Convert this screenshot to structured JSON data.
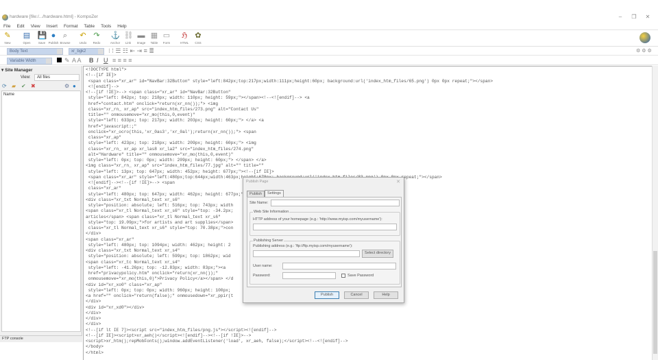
{
  "window": {
    "title": "hardware [file:/.../hardware.html] - KompoZer",
    "controls": [
      "–",
      "❐",
      "✕"
    ]
  },
  "menu": [
    "File",
    "Edit",
    "View",
    "Insert",
    "Format",
    "Table",
    "Tools",
    "Help"
  ],
  "toolbar": [
    {
      "label": "New",
      "icon": "pencil-icon",
      "glyph": "✎",
      "color": "#c9a000"
    },
    {
      "label": "Open",
      "icon": "open-icon",
      "glyph": "▤",
      "color": "#3a6fb0"
    },
    {
      "label": "Save",
      "icon": "save-icon",
      "glyph": "💾",
      "color": "#333"
    },
    {
      "label": "Publish",
      "icon": "globe-icon",
      "glyph": "●",
      "color": "#2d7fc4"
    },
    {
      "label": "Browse",
      "icon": "magnifier-icon",
      "glyph": "⌕",
      "color": "#777"
    },
    {
      "label": "Undo",
      "icon": "undo-icon",
      "glyph": "↶",
      "color": "#c9a000"
    },
    {
      "label": "Redo",
      "icon": "redo-icon",
      "glyph": "↷",
      "color": "#4a9a4a"
    },
    {
      "label": "Anchor",
      "icon": "anchor-icon",
      "glyph": "⚓",
      "color": "#999"
    },
    {
      "label": "Link",
      "icon": "link-icon",
      "glyph": "⛓",
      "color": "#aaa"
    },
    {
      "label": "Image",
      "icon": "image-icon",
      "glyph": "▬",
      "color": "#888"
    },
    {
      "label": "Table",
      "icon": "table-icon",
      "glyph": "▦",
      "color": "#999"
    },
    {
      "label": "Form",
      "icon": "form-icon",
      "glyph": "▭",
      "color": "#999"
    },
    {
      "label": "HTML",
      "icon": "html-icon",
      "glyph": "ℌ",
      "color": "#c03030"
    },
    {
      "label": "CSS",
      "icon": "css-icon",
      "glyph": "✿",
      "color": "#6a6a30"
    }
  ],
  "format": {
    "paragraph": "Body Text",
    "class": "xr_bgk2",
    "font": "Variable Width",
    "bold": "B",
    "italic": "I",
    "underline": "U"
  },
  "site_manager": {
    "title": "Site Manager",
    "view_label": "View:",
    "view_value": "All files",
    "column": "Name"
  },
  "ftp_console": "FTP console",
  "code_lines": [
    "<!DOCTYPE html\">",
    "<!--[if IE]>",
    " <span class=\"xr_ar\" id=\"NavBar:32Button\" style=\"left:842px;top:217px;width:111px;height:60px; background:url('index_htm_files/65.png') 0px 0px repeat;\"></span>",
    " <![endif]-->",
    "<!--[if !IE]>--> <span class=\"xr_ar\" id=\"NavBar:32Button\"",
    " style=\"left: 842px; top: 218px; width: 110px; height: 59px;\"></span><!--<![endif]--> <a",
    " href=\"contact.htm\" onclick=\"return(xr_nn());\"> <img",
    " class=\"xr_rn_ xr_ap\" src=\"index_htm_files/273.png\" alt=\"Contact Us\"",
    " title=\"\" onmousemove=\"xr_mo(this,0,event)\"",
    " style=\"left: 633px; top: 217px; width: 203px; height: 60px;\"> </a> <a",
    " href=\"javascript:;\"",
    " onclick=\"xr_ocro(this,'xr_0as3','xr_0al');return(xr_nn());\"> <span",
    " class=\"xr_ap\"",
    " style=\"left: 423px; top: 218px; width: 209px; height: 60px;\"> <img",
    " class=\"xr_rn_ xr_ap xr_las8 xr_la2\" src=\"index_htm_files/274.png\"",
    " alt=\"Hardware\" title=\"\" onmousemove=\"xr_mo(this,0,event)\"",
    " style=\"left: 0px; top: 0px; width: 209px; height: 60px;\"> </span> </a>",
    "<img class=\"xr_rn_ xr_ap\" src=\"index_htm_files/77.jpg\" alt=\"\" title=\"\"",
    " style=\"left: 13px; top: 647px; width: 452px; height: 677px;\"><!--[if IE]>",
    " <span class=\"xr_ar\" style=\"left:480px;top:644px;width:463px;height:678px; background:url('index_htm_files/83.png') 0px 0px repeat;\"></span>",
    " <![endif]--><!--[if !IE]>--> <span",
    " class=\"xr_ar\"",
    " style=\"left: 480px; top: 647px; width: 462px; height: 677px;\"></span>",
    "<div class=\"xr_txt Normal_text xr_s6\"",
    " style=\"position: absolute; left: 516px; top: 743px; width",
    "<span class=\"xr_tl Normal_text xr_s6\" style=\"top: -34.2px;",
    "articles</span> <span class=\"xr_tl Normal_text xr_s6\"",
    " style=\"top: 19.09px;\">for artists and art supplies</span>",
    " class=\"xr_tl Normal_text xr_s6\" style=\"top: 70.38px;\">con",
    "</div>",
    "<span class=\"xr_ar\"",
    " style=\"left: 480px; top: 1094px; width: 462px; height: 2",
    "<div class=\"xr_txt Normal_text xr_s4\"",
    " style=\"position: absolute; left: 599px; top: 1862px; wid",
    "<span class=\"xr_tc Normal_text xr_s4\"",
    " style=\"left: -41.26px; top: -12.83px; width: 83px;\"><a",
    " href=\"privacypolicy.htm\" onclick=\"return(xr_nn());\"",
    " onmousemove=\"xr_mo(this,0)\">Privacy Policy</a></span> </d",
    "<div id=\"xr_xo0\" class=\"xr_ap\"",
    " style=\"left: 0px; top: 0px; width: 960px; height: 100px;",
    "<a href=\"\" onclick=\"return(false);\" onmousedown=\"xr_ppir(t",
    "</div>",
    "<div id=\"xr_xd0\"></div>",
    "</div>",
    "</div>",
    "</div>",
    "<!--[if lt IE 7]><script src=\"index_htm_files/png.js\"></script><![endif]-->",
    "<!--[if IE]><script>xr_aeh()</script><![endif]--><!--[if !IE]>-->",
    "<script>xr_htm();repMobFonts();window.addEventListener('load', xr_aeh, false);</script><!--<![endif]-->",
    "</body>",
    "</html>"
  ],
  "dialog": {
    "title": "Publish Page",
    "close": "✕",
    "tabs": [
      "Publish",
      "Settings"
    ],
    "site_name_label": "Site Name:",
    "site_name_value": "",
    "web_group": "Web Site Information",
    "http_label": "HTTP address of your homepage (e.g.: 'http://www.myisp.com/myusername'):",
    "http_value": "",
    "server_group": "Publishing Server",
    "pub_label": "Publishing address (e.g.: 'ftp://ftp.myisp.com/myusername'):",
    "pub_value": "",
    "select_dir": "Select directory",
    "user_label": "User name:",
    "user_value": "",
    "pass_label": "Password:",
    "pass_value": "",
    "save_password": "Save Password",
    "save_password_checked": false,
    "buttons": {
      "publish": "Publish",
      "cancel": "Cancel",
      "help": "Help"
    }
  }
}
